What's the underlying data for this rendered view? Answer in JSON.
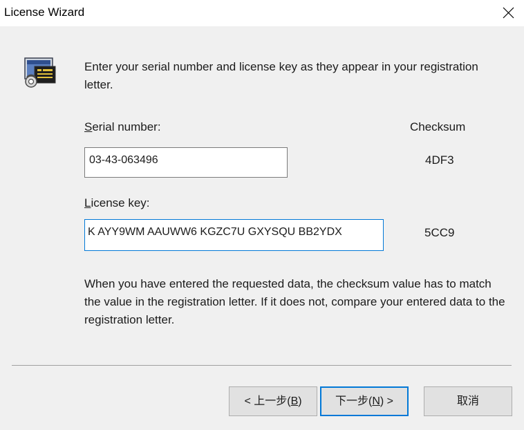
{
  "window": {
    "title": "License Wizard"
  },
  "icons": {
    "close": "close-icon",
    "wizard": "license-computer-key-icon"
  },
  "intro_text": "Enter your serial number and license key as they appear in your registration letter.",
  "serial": {
    "label_mnemonic": "S",
    "label_rest": "erial number:",
    "value": "03-43-063496",
    "checksum": "4DF3"
  },
  "license": {
    "label_mnemonic": "L",
    "label_rest": "icense key:",
    "value": "K AYY9WM AAUWW6 KGZC7U GXYSQU BB2YDX",
    "checksum": "5CC9"
  },
  "checksum_header": "Checksum",
  "help_text": "When you have entered the requested data, the checksum value has to match the value in the registration letter.  If it does not, compare your entered data to the registration letter.",
  "buttons": {
    "back": {
      "prefix": "< 上一步(",
      "mnemonic": "B",
      "suffix": ")"
    },
    "next": {
      "prefix": "下一步(",
      "mnemonic": "N",
      "suffix": ") >"
    },
    "cancel": "取消"
  },
  "colors": {
    "accent": "#0078d7",
    "panel": "#f0f0f0"
  }
}
